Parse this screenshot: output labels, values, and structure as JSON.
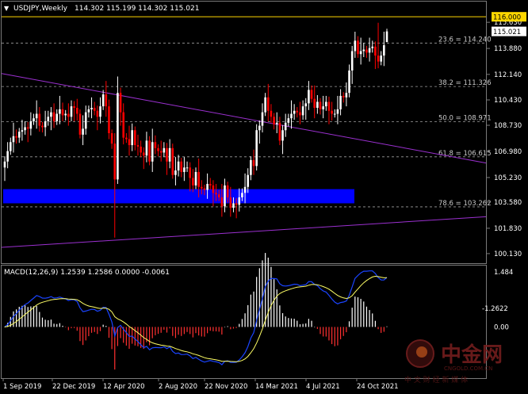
{
  "header": {
    "symbol": "USDJPY,Weekly",
    "ohlc": "114.302 115.199 114.302 115.021"
  },
  "colors": {
    "background": "#000000",
    "bull": "#ffffff",
    "bear": "#ff0000",
    "fib_line": "#a0a0a0",
    "trendline": "#9b30d0",
    "support_zone": "#0000ff",
    "price_level": "#ffd700",
    "macd_line": "#1a44ff",
    "signal_line": "#ffff66",
    "hist_pos": "#ffffff",
    "hist_neg": "#ff3030",
    "watermark": "#6b1a1a"
  },
  "price_axis": {
    "ticks": [
      "115.630",
      "113.880",
      "112.140",
      "110.430",
      "108.730",
      "106.980",
      "105.230",
      "103.580",
      "101.830",
      "100.130"
    ],
    "level_label": "116.000",
    "last_price_label": "115.021"
  },
  "fib_levels": [
    {
      "label": "23.6 = 114.240",
      "price": 114.24
    },
    {
      "label": "38.2 = 111.326",
      "price": 111.326
    },
    {
      "label": "50.0 = 108.971",
      "price": 108.971
    },
    {
      "label": "61.8 = 106.615",
      "price": 106.615
    },
    {
      "label": "78.6 = 103.262",
      "price": 103.262
    }
  ],
  "macd": {
    "title": "MACD(12,26,9) 1.2539 1.2586 0.0000 -0.0061",
    "ticks": [
      "1.484",
      "0.00"
    ],
    "min_label": "-1.2622"
  },
  "time_axis": [
    "1 Sep 2019",
    "22 Dec 2019",
    "12 Apr 2020",
    "2 Aug 2020",
    "22 Nov 2020",
    "14 Mar 2021",
    "4 Jul 2021",
    "24 Oct 2021"
  ],
  "watermark": {
    "brand": "中金网",
    "site": "CNGOLD.COM.CN",
    "tagline": "中 文 财 经 新 媒 体"
  },
  "chart_data": {
    "type": "candlestick",
    "title": "USDJPY,Weekly",
    "period": "Weekly",
    "ylim": [
      99.7,
      116.7
    ],
    "last_candle": {
      "open": 114.302,
      "high": 115.199,
      "low": 114.302,
      "close": 115.021
    },
    "closes": [
      106.3,
      107.0,
      107.6,
      108.0,
      107.9,
      108.3,
      108.4,
      108.6,
      108.5,
      109.0,
      109.2,
      109.5,
      108.7,
      108.6,
      109.0,
      109.3,
      109.6,
      109.0,
      109.5,
      109.8,
      109.4,
      109.5,
      109.3,
      110.0,
      109.9,
      109.5,
      108.1,
      108.5,
      109.6,
      109.8,
      109.9,
      109.7,
      109.3,
      110.0,
      110.8,
      110.0,
      108.2,
      107.5,
      105.1,
      110.9,
      109.6,
      107.9,
      107.8,
      107.4,
      108.4,
      107.4,
      107.3,
      106.9,
      106.7,
      107.7,
      106.3,
      107.6,
      107.2,
      107.0,
      106.9,
      107.2,
      106.3,
      107.2,
      105.4,
      105.7,
      106.3,
      105.6,
      105.9,
      105.9,
      105.2,
      104.7,
      105.6,
      104.6,
      104.5,
      104.4,
      104.8,
      104.7,
      104.2,
      104.1,
      103.9,
      103.3,
      104.7,
      103.9,
      103.2,
      103.5,
      103.4,
      103.9,
      104.2,
      104.6,
      105.4,
      106.4,
      106.0,
      108.4,
      108.7,
      109.6,
      110.6,
      109.7,
      109.3,
      108.8,
      108.9,
      107.7,
      108.4,
      108.9,
      109.2,
      109.5,
      109.7,
      109.6,
      109.4,
      110.0,
      110.2,
      111.1,
      110.5,
      109.9,
      110.3,
      109.8,
      110.0,
      110.3,
      109.7,
      109.5,
      109.5,
      109.8,
      110.7,
      110.6,
      110.9,
      112.4,
      113.7,
      114.4,
      113.5,
      113.7,
      113.8,
      113.6,
      113.9,
      114.0,
      113.4,
      113.0,
      113.4,
      114.1,
      115.021
    ],
    "fib_retracement": [
      114.24,
      111.326,
      108.971,
      106.615,
      103.262
    ],
    "horizontal_level": 116.0,
    "support_zone": [
      103.5,
      104.45
    ],
    "macd": {
      "fast": 12,
      "slow": 26,
      "signal": 9,
      "macd": 1.2539,
      "signal_value": 1.2586,
      "histogram": 0.0,
      "extra": -0.0061,
      "ylim": [
        -1.2622,
        1.484
      ]
    }
  }
}
